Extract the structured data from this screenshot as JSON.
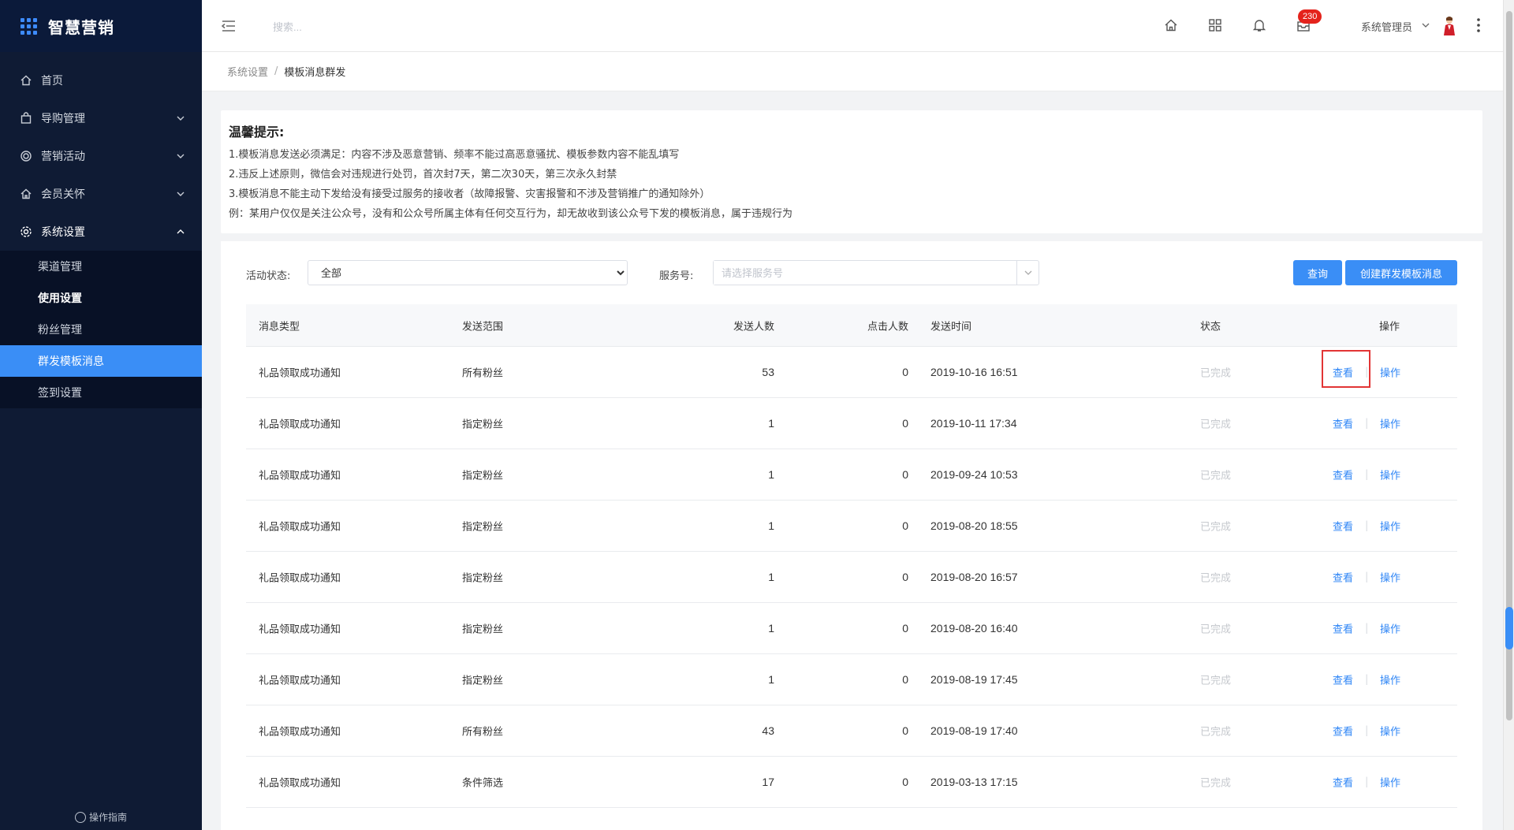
{
  "app": {
    "title": "智慧营销"
  },
  "sidebar": {
    "items": [
      {
        "label": "首页",
        "icon": "home-icon"
      },
      {
        "label": "导购管理",
        "icon": "bag-icon"
      },
      {
        "label": "营销活动",
        "icon": "target-icon"
      },
      {
        "label": "会员关怀",
        "icon": "house-icon"
      },
      {
        "label": "系统设置",
        "icon": "gear-icon"
      }
    ],
    "submenu": [
      {
        "label": "渠道管理"
      },
      {
        "label": "使用设置"
      },
      {
        "label": "粉丝管理"
      },
      {
        "label": "群发模板消息"
      },
      {
        "label": "签到设置"
      }
    ],
    "guide": "操作指南"
  },
  "topbar": {
    "search_placeholder": "搜索...",
    "badge": "230",
    "user": "系统管理员"
  },
  "breadcrumb": {
    "parent": "系统设置",
    "separator": "/",
    "current": "模板消息群发"
  },
  "notice": {
    "title": "温馨提示:",
    "lines": [
      "1.模板消息发送必须满足：内容不涉及恶意营销、频率不能过高恶意骚扰、模板参数内容不能乱填写",
      "2.违反上述原则，微信会对违规进行处罚，首次封7天，第二次30天，第三次永久封禁",
      "3.模板消息不能主动下发给没有接受过服务的接收者（故障报警、灾害报警和不涉及营销推广的通知除外）",
      "例：某用户仅仅是关注公众号，没有和公众号所属主体有任何交互行为，却无故收到该公众号下发的模板消息，属于违规行为"
    ]
  },
  "filters": {
    "status_label": "活动状态:",
    "status_value": "全部",
    "service_label": "服务号:",
    "service_placeholder": "请选择服务号",
    "query_button": "查询",
    "create_button": "创建群发模板消息"
  },
  "table": {
    "headers": {
      "type": "消息类型",
      "scope": "发送范围",
      "sent": "发送人数",
      "clicks": "点击人数",
      "time": "发送时间",
      "status": "状态",
      "ops": "操作"
    },
    "rows": [
      {
        "type": "礼品领取成功通知",
        "scope": "所有粉丝",
        "sent": "53",
        "clicks": "0",
        "time": "2019-10-16 16:51",
        "status": "已完成",
        "view": "查看",
        "sep": "|",
        "op": "操作"
      },
      {
        "type": "礼品领取成功通知",
        "scope": "指定粉丝",
        "sent": "1",
        "clicks": "0",
        "time": "2019-10-11 17:34",
        "status": "已完成",
        "view": "查看",
        "sep": "|",
        "op": "操作"
      },
      {
        "type": "礼品领取成功通知",
        "scope": "指定粉丝",
        "sent": "1",
        "clicks": "0",
        "time": "2019-09-24 10:53",
        "status": "已完成",
        "view": "查看",
        "sep": "|",
        "op": "操作"
      },
      {
        "type": "礼品领取成功通知",
        "scope": "指定粉丝",
        "sent": "1",
        "clicks": "0",
        "time": "2019-08-20 18:55",
        "status": "已完成",
        "view": "查看",
        "sep": "|",
        "op": "操作"
      },
      {
        "type": "礼品领取成功通知",
        "scope": "指定粉丝",
        "sent": "1",
        "clicks": "0",
        "time": "2019-08-20 16:57",
        "status": "已完成",
        "view": "查看",
        "sep": "|",
        "op": "操作"
      },
      {
        "type": "礼品领取成功通知",
        "scope": "指定粉丝",
        "sent": "1",
        "clicks": "0",
        "time": "2019-08-20 16:40",
        "status": "已完成",
        "view": "查看",
        "sep": "|",
        "op": "操作"
      },
      {
        "type": "礼品领取成功通知",
        "scope": "指定粉丝",
        "sent": "1",
        "clicks": "0",
        "time": "2019-08-19 17:45",
        "status": "已完成",
        "view": "查看",
        "sep": "|",
        "op": "操作"
      },
      {
        "type": "礼品领取成功通知",
        "scope": "所有粉丝",
        "sent": "43",
        "clicks": "0",
        "time": "2019-08-19 17:40",
        "status": "已完成",
        "view": "查看",
        "sep": "|",
        "op": "操作"
      },
      {
        "type": "礼品领取成功通知",
        "scope": "条件筛选",
        "sent": "17",
        "clicks": "0",
        "time": "2019-03-13 17:15",
        "status": "已完成",
        "view": "查看",
        "sep": "|",
        "op": "操作"
      }
    ]
  },
  "colors": {
    "sidebar": "#0f1b34",
    "accent": "#3a8ef6",
    "highlight": "#e23535",
    "badge": "#e4231c"
  }
}
